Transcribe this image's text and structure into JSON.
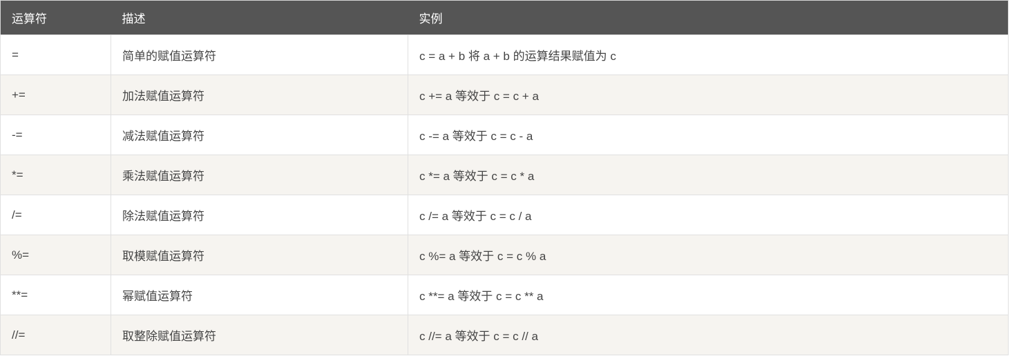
{
  "table": {
    "headers": {
      "operator": "运算符",
      "description": "描述",
      "example": "实例"
    },
    "rows": [
      {
        "operator": "=",
        "description": "简单的赋值运算符",
        "example": "c = a + b 将 a + b 的运算结果赋值为 c"
      },
      {
        "operator": "+=",
        "description": "加法赋值运算符",
        "example": "c += a 等效于 c = c + a"
      },
      {
        "operator": "-=",
        "description": "减法赋值运算符",
        "example": "c -= a 等效于 c = c - a"
      },
      {
        "operator": "*=",
        "description": "乘法赋值运算符",
        "example": "c *= a 等效于 c = c * a"
      },
      {
        "operator": "/=",
        "description": "除法赋值运算符",
        "example": "c /= a 等效于 c = c / a"
      },
      {
        "operator": "%=",
        "description": "取模赋值运算符",
        "example": "c %= a 等效于 c = c % a"
      },
      {
        "operator": "**=",
        "description": "幂赋值运算符",
        "example": "c **= a 等效于 c = c ** a"
      },
      {
        "operator": "//=",
        "description": "取整除赋值运算符",
        "example": "c //= a 等效于 c = c // a"
      }
    ]
  }
}
